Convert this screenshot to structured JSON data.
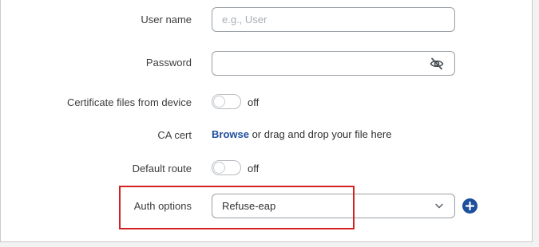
{
  "form": {
    "username": {
      "label": "User name",
      "placeholder": "e.g., User",
      "value": ""
    },
    "password": {
      "label": "Password",
      "value": "",
      "visibility_icon": "eye-off-icon"
    },
    "cert_from_device": {
      "label": "Certificate files from device",
      "state": "off"
    },
    "ca_cert": {
      "label": "CA cert",
      "browse_label": "Browse",
      "drop_text": " or drag and drop your file here"
    },
    "default_route": {
      "label": "Default route",
      "state": "off"
    },
    "auth_options": {
      "label": "Auth options",
      "selected": "Refuse-eap",
      "dropdown_icon": "chevron-down-icon",
      "add_icon": "plus-circle-icon"
    }
  },
  "colors": {
    "accent": "#1d4f9c",
    "highlight": "#d42222",
    "border": "#9aa0a6"
  }
}
